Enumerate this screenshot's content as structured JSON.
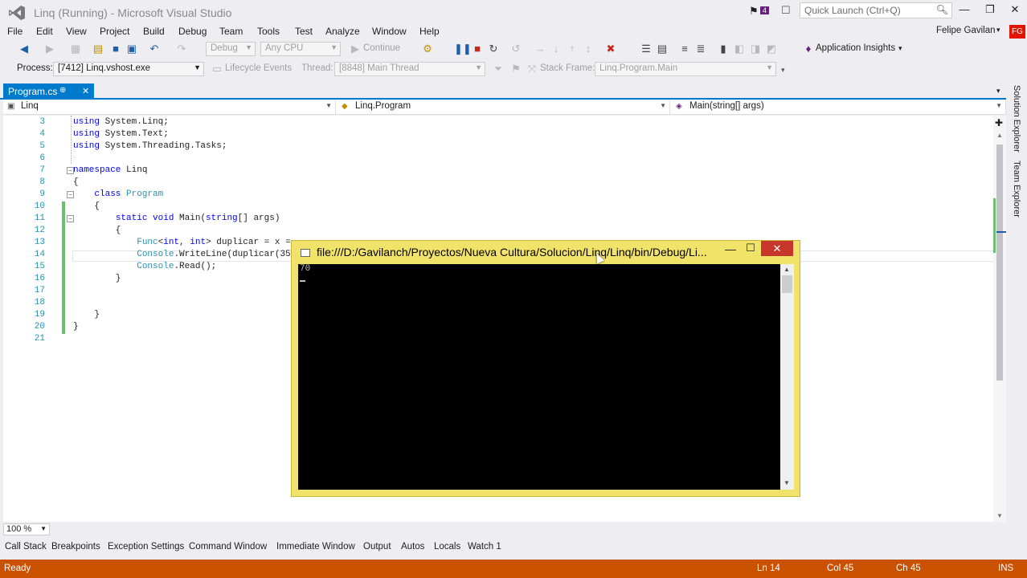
{
  "window": {
    "title": "Linq (Running) - Microsoft Visual Studio",
    "notification_count": "4",
    "quick_launch_placeholder": "Quick Launch (Ctrl+Q)"
  },
  "menu": [
    "File",
    "Edit",
    "View",
    "Project",
    "Build",
    "Debug",
    "Team",
    "Tools",
    "Test",
    "Analyze",
    "Window",
    "Help"
  ],
  "user": {
    "name": "Felipe Gavilan",
    "initials": "FG"
  },
  "toolbar": {
    "config": "Debug",
    "platform": "Any CPU",
    "continue_label": "Continue",
    "application_insights": "Application Insights"
  },
  "debug_location": {
    "process_label": "Process:",
    "process_value": "[7412] Linq.vshost.exe",
    "lifecycle_label": "Lifecycle Events",
    "thread_label": "Thread:",
    "thread_value": "[8848] Main Thread",
    "stackframe_label": "Stack Frame:",
    "stackframe_value": "Linq.Program.Main"
  },
  "document_tab": {
    "label": "Program.cs"
  },
  "navbar": {
    "project": "Linq",
    "type": "Linq.Program",
    "member": "Main(string[] args)"
  },
  "code_lines": [
    {
      "n": "3",
      "text": "using System.Linq;"
    },
    {
      "n": "4",
      "text": "using System.Text;"
    },
    {
      "n": "5",
      "text": "using System.Threading.Tasks;"
    },
    {
      "n": "6",
      "text": ""
    },
    {
      "n": "7",
      "text": "namespace Linq"
    },
    {
      "n": "8",
      "text": "{"
    },
    {
      "n": "9",
      "text": "    class Program"
    },
    {
      "n": "10",
      "text": "    {"
    },
    {
      "n": "11",
      "text": "        static void Main(string[] args)"
    },
    {
      "n": "12",
      "text": "        {"
    },
    {
      "n": "13",
      "text": "            Func<int, int> duplicar = x ="
    },
    {
      "n": "14",
      "text": "            Console.WriteLine(duplicar(35"
    },
    {
      "n": "15",
      "text": "            Console.Read();"
    },
    {
      "n": "16",
      "text": "        }"
    },
    {
      "n": "17",
      "text": ""
    },
    {
      "n": "18",
      "text": ""
    },
    {
      "n": "19",
      "text": "    }"
    },
    {
      "n": "20",
      "text": "}"
    },
    {
      "n": "21",
      "text": ""
    }
  ],
  "zoom": "100 %",
  "tool_windows": [
    "Call Stack",
    "Breakpoints",
    "Exception Settings",
    "Command Window",
    "Immediate Window",
    "Output",
    "Autos",
    "Locals",
    "Watch 1"
  ],
  "side_tabs": [
    "Solution Explorer",
    "Team Explorer"
  ],
  "status": {
    "state": "Ready",
    "line": "Ln 14",
    "col": "Col 45",
    "ch": "Ch 45",
    "mode": "INS"
  },
  "console_window": {
    "title": "file:///D:/Gavilanch/Proyectos/Nueva Cultura/Solucion/Linq/Linq/bin/Debug/Li...",
    "output": "70"
  },
  "colors": {
    "accent": "#007acc",
    "statusbar": "#ca5100",
    "console_frame": "#f1e26a",
    "close_red": "#c7362b"
  }
}
